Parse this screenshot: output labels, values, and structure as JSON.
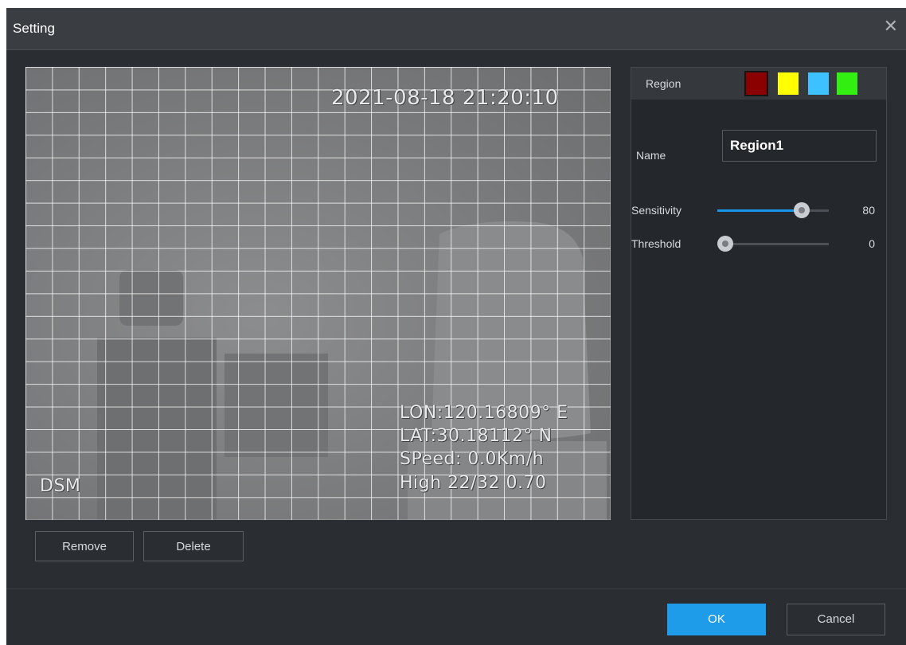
{
  "dialog": {
    "title": "Setting",
    "close_icon": "close-icon"
  },
  "video": {
    "timestamp": "2021-08-18 21:20:10",
    "longitude": "LON:120.16809° E",
    "latitude": "LAT:30.18112° N",
    "speed": "SPeed: 0.0Km/h",
    "high": "High 22/32 0.70",
    "channel_label": "DSM"
  },
  "actions": {
    "remove_label": "Remove",
    "delete_label": "Delete"
  },
  "panel": {
    "region_label": "Region",
    "region_colors": [
      "#8b0000",
      "#ffff00",
      "#3ec1ff",
      "#33ee11"
    ],
    "selected_region_index": 0,
    "name_label": "Name",
    "name_value": "Region1",
    "sliders": [
      {
        "label": "Sensitivity",
        "value": "80",
        "percent": 80
      },
      {
        "label": "Threshold",
        "value": "0",
        "percent": 0
      }
    ]
  },
  "footer": {
    "ok_label": "OK",
    "cancel_label": "Cancel"
  },
  "colors": {
    "accent": "#1e9be9",
    "background": "#2a2d31"
  }
}
